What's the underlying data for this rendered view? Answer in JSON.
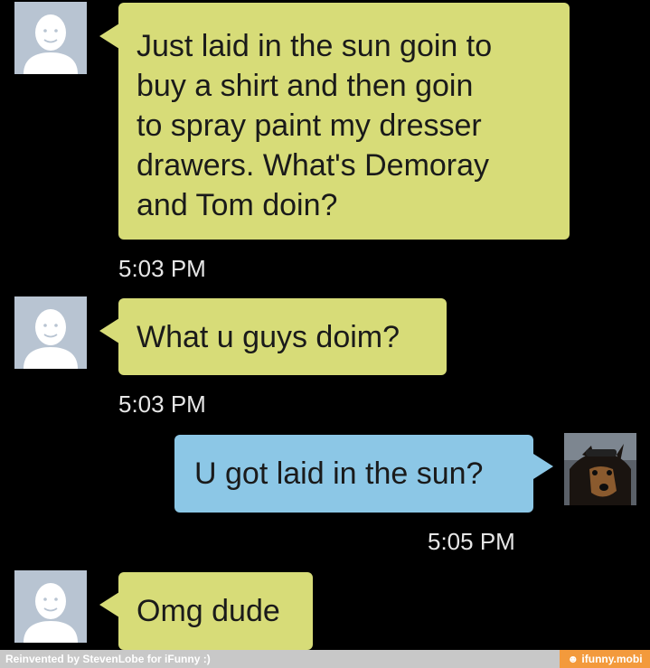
{
  "conversation": {
    "messages": [
      {
        "direction": "incoming",
        "text": "Just laid in the sun goin to\nbuy a shirt and then goin\nto spray paint my dresser\ndrawers. What's Demoray\nand Tom doin?",
        "time": "5:03 PM",
        "avatar_icon": "default-person-icon"
      },
      {
        "direction": "incoming",
        "text": "What u guys doim?",
        "time": "5:03 PM",
        "avatar_icon": "default-person-icon"
      },
      {
        "direction": "outgoing",
        "text": "U got laid in the sun?",
        "time": "5:05 PM",
        "avatar_icon": "dog-photo-avatar"
      },
      {
        "direction": "incoming",
        "text": "Omg dude",
        "avatar_icon": "default-person-icon"
      }
    ]
  },
  "footer": {
    "credit": "Reinvented by StevenLobe for iFunny :)",
    "watermark": "☻ ifunny.mobi"
  },
  "colors": {
    "background": "#000000",
    "incoming_bubble": "#d7dc78",
    "outgoing_bubble": "#8cc7e6",
    "timestamp": "#e6e6e6",
    "footer_bar": "#c8c8c8",
    "watermark_bg": "#f39a3c"
  }
}
